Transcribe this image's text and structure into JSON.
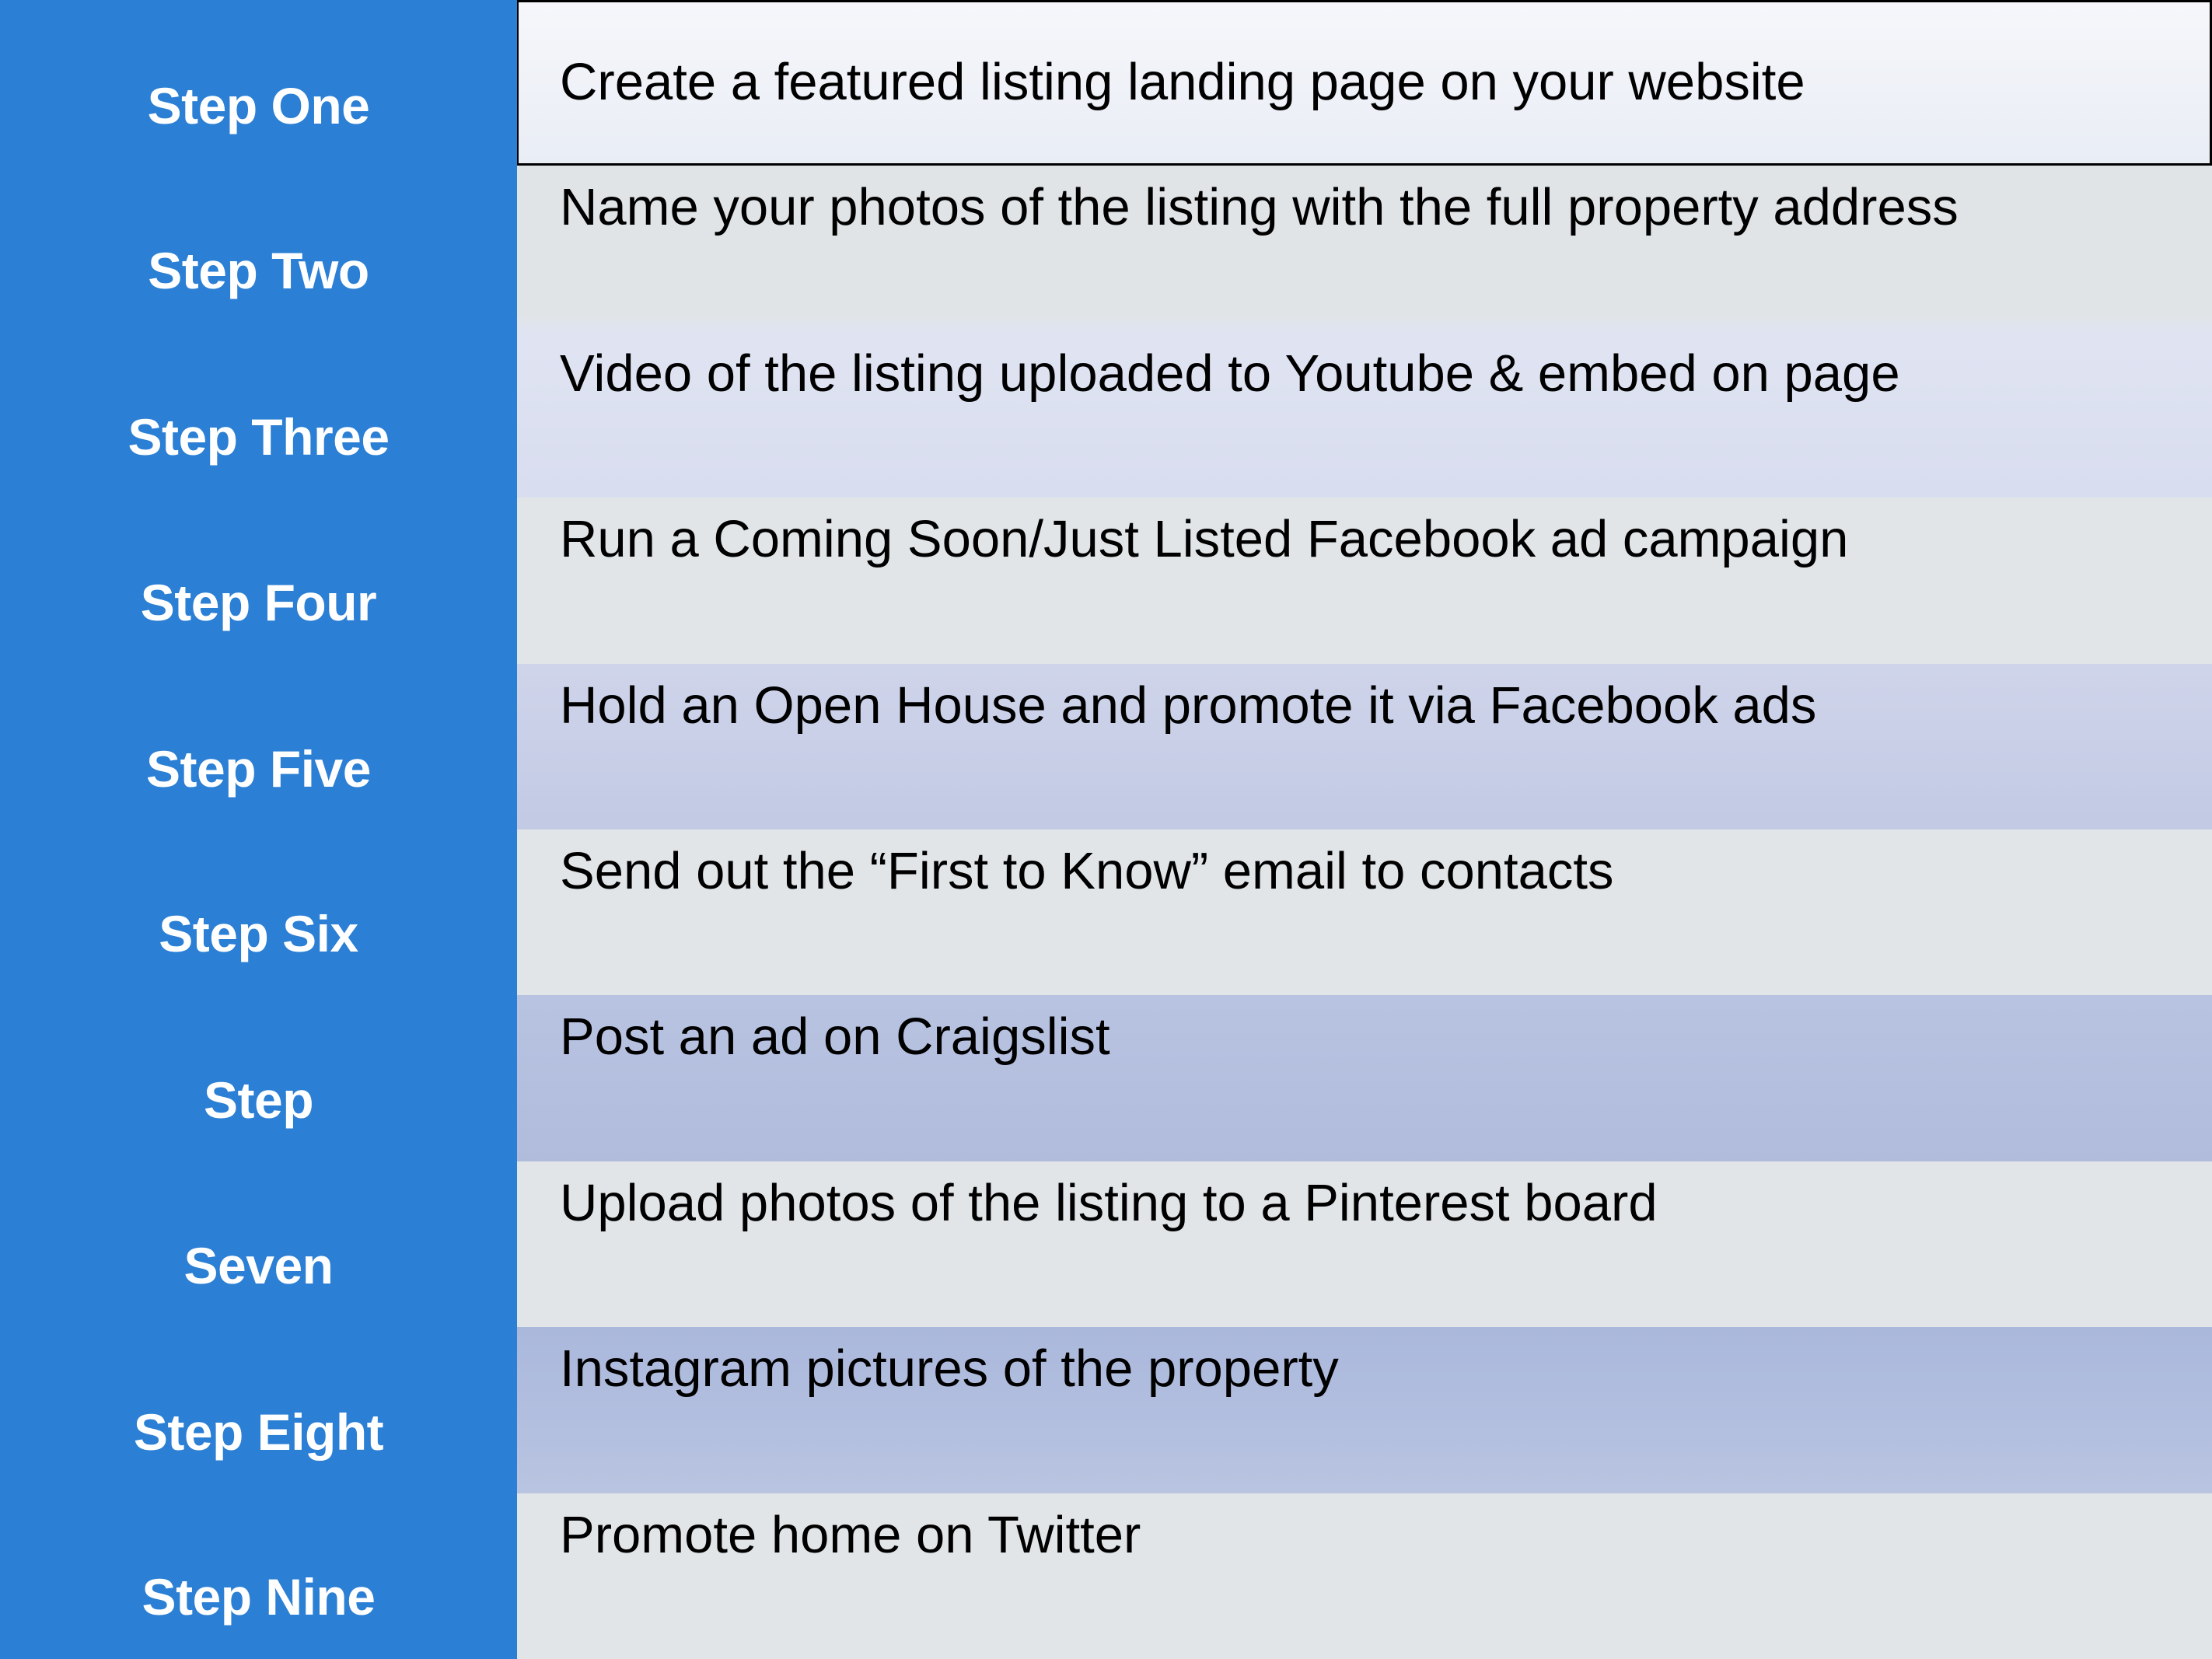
{
  "labels": [
    "Step One",
    "Step Two",
    "Step Three",
    "Step Four",
    "Step Five",
    "Step Six",
    "Step",
    "Seven",
    "Step Eight",
    "Step Nine"
  ],
  "steps": [
    "Create a featured listing landing page on your website",
    "Name your photos of the listing with the full property address",
    "Video of the listing uploaded to Youtube & embed on page",
    "Run a Coming Soon/Just Listed Facebook ad campaign",
    "Hold an Open House and promote it via Facebook ads",
    "Send out the “First to Know” email to contacts",
    "Post an ad on Craigslist",
    "Upload photos of the listing to a Pinterest board",
    "Instagram pictures of the property",
    "Promote home on Twitter"
  ],
  "colors": {
    "label_column": "#2b7fd4",
    "label_text": "#ffffff",
    "row_text": "#000000"
  }
}
